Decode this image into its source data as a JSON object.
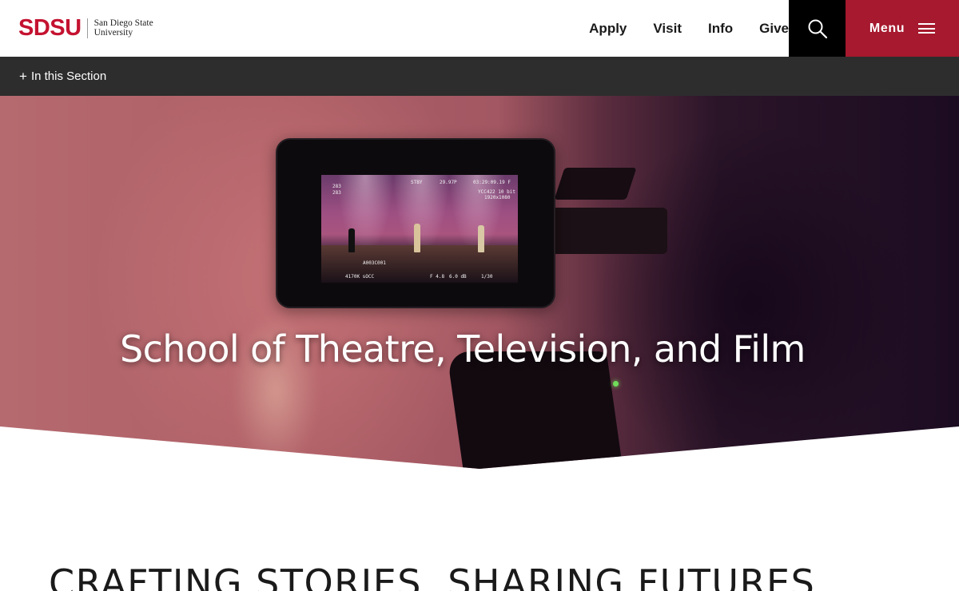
{
  "header": {
    "logo": {
      "mark": "SDSU",
      "line1": "San Diego State",
      "line2": "University"
    },
    "nav": [
      {
        "label": "Apply"
      },
      {
        "label": "Visit"
      },
      {
        "label": "Info"
      },
      {
        "label": "Give"
      }
    ],
    "search": {
      "icon": "search-icon"
    },
    "menu": {
      "label": "Menu",
      "icon": "hamburger-icon"
    }
  },
  "section_bar": {
    "icon": "plus-icon",
    "label": "In this Section"
  },
  "hero": {
    "title": "School of Theatre, Television, and Film",
    "monitor_osd": {
      "top_left_1": "283",
      "top_left_2": "283",
      "stby": "STBY",
      "fps": "29.97P",
      "timecode": "03:29:09.19 F",
      "format": "YCC422 10 bit",
      "resolution": "1920x1080",
      "clip": "A003C001",
      "bottom_left": "4170K sOCC",
      "iris": "F 4.8",
      "gain": "6.0 dB",
      "shutter": "1/30"
    }
  },
  "content": {
    "heading": "CRAFTING STORIES, SHARING FUTURES"
  },
  "colors": {
    "brand_red": "#c41230",
    "menu_red": "#a6192e",
    "section_bar": "#2d2d2d",
    "search_bg": "#000000"
  }
}
